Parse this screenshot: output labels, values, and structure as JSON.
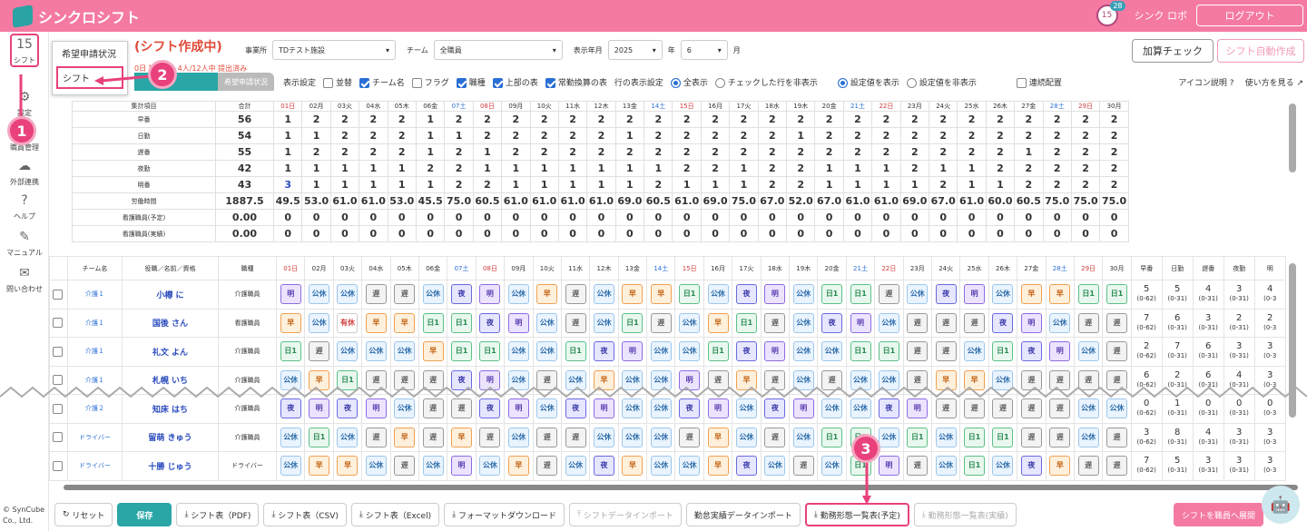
{
  "header": {
    "app_name": "シンクロシフト",
    "badge_count": "28",
    "badge_icon": "15",
    "user": "シンク ロボ",
    "logout": "ログアウト"
  },
  "sidebar": [
    {
      "label": "シフト",
      "icon": "15",
      "name": "sidebar-item-shift"
    },
    {
      "label": "設定",
      "icon": "⚙",
      "name": "sidebar-item-settings"
    },
    {
      "label": "職員管理",
      "icon": "☰",
      "name": "sidebar-item-staff"
    },
    {
      "label": "外部連携",
      "icon": "☁",
      "name": "sidebar-item-external"
    },
    {
      "label": "ヘルプ",
      "icon": "?",
      "name": "sidebar-item-help"
    },
    {
      "label": "マニュアル",
      "icon": "✎",
      "name": "sidebar-item-manual"
    },
    {
      "label": "問い合わせ",
      "icon": "✉",
      "name": "sidebar-item-contact"
    }
  ],
  "copyright": {
    "line1": "© SynCube",
    "line2": "Co., Ltd."
  },
  "popup": {
    "item1": "希望申請状況",
    "item2": "シフト"
  },
  "markers": [
    "1",
    "2",
    "3"
  ],
  "page": {
    "title": "(シフト作成中)",
    "status_prefix": "0日",
    "status": "請状況：4人/12人中 提出済み",
    "tab_request": "希望申請状況"
  },
  "filters": {
    "office_label": "事業所",
    "office_value": "TDテスト施設",
    "team_label": "チーム",
    "team_value": "全職員",
    "month_label": "表示年月",
    "year_value": "2025",
    "year_unit": "年",
    "month_value": "6",
    "month_unit": "月"
  },
  "actions": {
    "check": "加算チェック",
    "auto": "シフト自動作成"
  },
  "display": {
    "label": "表示設定",
    "opt1": "並替",
    "opt2": "チーム名",
    "opt3": "フラグ",
    "opt4": "職種",
    "opt5": "上部の表",
    "opt6": "常勤換算の表",
    "row_label": "行の表示設定",
    "r1": "全表示",
    "r2": "チェックした行を非表示",
    "r3": "設定値を表示",
    "r4": "設定値を非表示",
    "opt7": "連続配置",
    "icon_help": "アイコン説明",
    "howto": "使い方を見る"
  },
  "agg": {
    "head_label": "集計項目",
    "head_total": "合計",
    "days": [
      "01日",
      "02月",
      "03火",
      "04水",
      "05木",
      "06金",
      "07土",
      "08日",
      "09月",
      "10火",
      "11水",
      "12木",
      "13金",
      "14土",
      "15日",
      "16月",
      "17火",
      "18水",
      "19木",
      "20金",
      "21土",
      "22日",
      "23月",
      "24火",
      "25水",
      "26木",
      "27金",
      "28土",
      "29日",
      "30月"
    ],
    "rows": [
      {
        "label": "早番",
        "total": "56",
        "vals": [
          "1",
          "2",
          "2",
          "2",
          "2",
          "1",
          "2",
          "2",
          "2",
          "2",
          "2",
          "2",
          "2",
          "2",
          "2",
          "2",
          "2",
          "2",
          "2",
          "2",
          "2",
          "2",
          "2",
          "2",
          "2",
          "2",
          "2",
          "2",
          "2",
          "2"
        ]
      },
      {
        "label": "日勤",
        "total": "54",
        "vals": [
          "1",
          "1",
          "2",
          "2",
          "2",
          "1",
          "1",
          "2",
          "2",
          "2",
          "2",
          "2",
          "1",
          "2",
          "2",
          "2",
          "2",
          "2",
          "1",
          "2",
          "2",
          "2",
          "2",
          "2",
          "2",
          "2",
          "2",
          "2",
          "2",
          "2"
        ]
      },
      {
        "label": "遅番",
        "total": "55",
        "vals": [
          "1",
          "2",
          "2",
          "2",
          "2",
          "1",
          "2",
          "1",
          "2",
          "2",
          "2",
          "2",
          "2",
          "2",
          "2",
          "2",
          "2",
          "2",
          "2",
          "2",
          "2",
          "2",
          "2",
          "2",
          "2",
          "2",
          "1",
          "2",
          "2",
          "2"
        ]
      },
      {
        "label": "夜勤",
        "total": "42",
        "vals": [
          "1",
          "1",
          "1",
          "1",
          "1",
          "2",
          "2",
          "1",
          "1",
          "1",
          "1",
          "1",
          "1",
          "1",
          "2",
          "2",
          "1",
          "2",
          "2",
          "1",
          "1",
          "1",
          "2",
          "1",
          "1",
          "2",
          "2",
          "2",
          "2",
          "2"
        ]
      },
      {
        "label": "明番",
        "total": "43",
        "vals": [
          "3",
          "1",
          "1",
          "1",
          "1",
          "1",
          "2",
          "2",
          "1",
          "1",
          "1",
          "1",
          "1",
          "2",
          "1",
          "1",
          "1",
          "2",
          "2",
          "1",
          "1",
          "1",
          "1",
          "2",
          "1",
          "1",
          "2",
          "2",
          "2",
          "2"
        ]
      },
      {
        "label": "労働時間",
        "total": "1887.5",
        "vals": [
          "49.5",
          "53.0",
          "61.0",
          "61.0",
          "53.0",
          "45.5",
          "75.0",
          "60.5",
          "61.0",
          "61.0",
          "61.0",
          "61.0",
          "69.0",
          "60.5",
          "61.0",
          "69.0",
          "75.0",
          "67.0",
          "52.0",
          "67.0",
          "61.0",
          "61.0",
          "69.0",
          "67.0",
          "61.0",
          "60.0",
          "60.5",
          "75.0",
          "75.0",
          "75.0"
        ]
      },
      {
        "label": "看護職員(予定)",
        "total": "0.00",
        "vals": [
          "0",
          "0",
          "0",
          "0",
          "0",
          "0",
          "0",
          "0",
          "0",
          "0",
          "0",
          "0",
          "0",
          "0",
          "0",
          "0",
          "0",
          "0",
          "0",
          "0",
          "0",
          "0",
          "0",
          "0",
          "0",
          "0",
          "0",
          "0",
          "0",
          "0"
        ]
      },
      {
        "label": "看護職員(実績)",
        "total": "0.00",
        "vals": [
          "0",
          "0",
          "0",
          "0",
          "0",
          "0",
          "0",
          "0",
          "0",
          "0",
          "0",
          "0",
          "0",
          "0",
          "0",
          "0",
          "0",
          "0",
          "0",
          "0",
          "0",
          "0",
          "0",
          "0",
          "0",
          "0",
          "0",
          "0",
          "0",
          "0"
        ]
      }
    ]
  },
  "grid": {
    "head": {
      "team": "チーム名",
      "role": "役職／名前／資格",
      "job": "職種",
      "sums": [
        "早番",
        "日勤",
        "遅番",
        "夜勤",
        "明"
      ]
    },
    "rows": [
      {
        "team": "介護１",
        "name": "小樽 に",
        "job": "介護職員",
        "shifts": [
          "明",
          "公休",
          "公休",
          "遅",
          "遅",
          "公休",
          "夜",
          "明",
          "公休",
          "早",
          "遅",
          "公休",
          "早",
          "早",
          "日1",
          "公休",
          "夜",
          "明",
          "公休",
          "日1",
          "日1",
          "遅",
          "公休",
          "夜",
          "明",
          "公休",
          "早",
          "早",
          "日1",
          "日1"
        ],
        "sums": [
          {
            "v": "5",
            "r": "(0-62)"
          },
          {
            "v": "5",
            "r": "(0-31)"
          },
          {
            "v": "4",
            "r": "(0-31)"
          },
          {
            "v": "3",
            "r": "(0-31)"
          },
          {
            "v": "4",
            "r": "(0-3"
          }
        ]
      },
      {
        "team": "介護１",
        "name": "国後 さん",
        "job": "看護職員",
        "shifts": [
          "早",
          "公休",
          "有休",
          "早",
          "早",
          "日1",
          "日1",
          "夜",
          "明",
          "公休",
          "遅",
          "公休",
          "日1",
          "遅",
          "公休",
          "早",
          "日1",
          "遅",
          "公休",
          "夜",
          "明",
          "公休",
          "遅",
          "遅",
          "遅",
          "夜",
          "明",
          "公休",
          "遅",
          "遅"
        ],
        "sums": [
          {
            "v": "7",
            "r": "(0-62)"
          },
          {
            "v": "6",
            "r": "(0-31)"
          },
          {
            "v": "3",
            "r": "(0-31)"
          },
          {
            "v": "2",
            "r": "(0-31)"
          },
          {
            "v": "2",
            "r": "(0-3"
          }
        ]
      },
      {
        "team": "介護１",
        "name": "礼文 よん",
        "job": "介護職員",
        "shifts": [
          "日1",
          "遅",
          "公休",
          "公休",
          "公休",
          "早",
          "日1",
          "日1",
          "公休",
          "公休",
          "日1",
          "夜",
          "明",
          "公休",
          "公休",
          "日1",
          "夜",
          "明",
          "公休",
          "公休",
          "日1",
          "日1",
          "遅",
          "遅",
          "公休",
          "日1",
          "夜",
          "明",
          "公休",
          "遅"
        ],
        "sums": [
          {
            "v": "2",
            "r": "(0-62)"
          },
          {
            "v": "7",
            "r": "(0-31)"
          },
          {
            "v": "6",
            "r": "(0-31)"
          },
          {
            "v": "3",
            "r": "(0-31)"
          },
          {
            "v": "3",
            "r": "(0-3"
          }
        ]
      },
      {
        "team": "介護１",
        "name": "札幌 いち",
        "job": "介護職員",
        "shifts": [
          "公休",
          "早",
          "日1",
          "遅",
          "遅",
          "遅",
          "夜",
          "明",
          "公休",
          "遅",
          "公休",
          "早",
          "公休",
          "公休",
          "明",
          "遅",
          "早",
          "遅",
          "公休",
          "遅",
          "公休",
          "公休",
          "遅",
          "早",
          "早",
          "公休",
          "遅",
          "遅",
          "遅",
          "遅"
        ],
        "sums": [
          {
            "v": "6",
            "r": "(0-62)"
          },
          {
            "v": "2",
            "r": "(0-31)"
          },
          {
            "v": "6",
            "r": "(0-31)"
          },
          {
            "v": "4",
            "r": "(0-31)"
          },
          {
            "v": "3",
            "r": "(0-3"
          }
        ]
      },
      {
        "team": "介護２",
        "name": "知床 はち",
        "job": "介護職員",
        "shifts": [
          "夜",
          "明",
          "夜",
          "明",
          "公休",
          "遅",
          "遅",
          "夜",
          "明",
          "公休",
          "夜",
          "明",
          "公休",
          "公休",
          "夜",
          "明",
          "公休",
          "夜",
          "明",
          "公休",
          "公休",
          "夜",
          "明",
          "遅",
          "遅",
          "遅",
          "遅",
          "遅",
          "公休",
          "公休"
        ],
        "sums": [
          {
            "v": "0",
            "r": "(0-62)"
          },
          {
            "v": "1",
            "r": "(0-31)"
          },
          {
            "v": "0",
            "r": "(0-31)"
          },
          {
            "v": "0",
            "r": "(0-31)"
          },
          {
            "v": "0",
            "r": "(0-3"
          }
        ]
      },
      {
        "team": "ドライバー",
        "name": "留萌 きゅう",
        "job": "介護職員",
        "shifts": [
          "公休",
          "日1",
          "公休",
          "遅",
          "早",
          "遅",
          "早",
          "遅",
          "公休",
          "遅",
          "遅",
          "公休",
          "公休",
          "公休",
          "遅",
          "早",
          "公休",
          "遅",
          "公休",
          "日1",
          "日1",
          "公休",
          "日1",
          "公休",
          "日1",
          "日1",
          "遅",
          "遅",
          "公休",
          "遅"
        ],
        "sums": [
          {
            "v": "3",
            "r": "(0-62)"
          },
          {
            "v": "8",
            "r": "(0-31)"
          },
          {
            "v": "4",
            "r": "(0-31)"
          },
          {
            "v": "3",
            "r": "(0-31)"
          },
          {
            "v": "3",
            "r": "(0-3"
          }
        ]
      },
      {
        "team": "ドライバー",
        "name": "十勝 じゅう",
        "job": "ドライバー",
        "shifts": [
          "公休",
          "早",
          "早",
          "公休",
          "遅",
          "公休",
          "明",
          "公休",
          "早",
          "遅",
          "公休",
          "夜",
          "早",
          "公休",
          "公休",
          "早",
          "夜",
          "公休",
          "遅",
          "公休",
          "日1",
          "明",
          "遅",
          "公休",
          "日1",
          "公休",
          "夜",
          "早",
          "遅",
          "遅"
        ],
        "sums": [
          {
            "v": "7",
            "r": "(0-62)"
          },
          {
            "v": "5",
            "r": "(0-31)"
          },
          {
            "v": "3",
            "r": "(0-31)"
          },
          {
            "v": "3",
            "r": "(0-31)"
          },
          {
            "v": "3",
            "r": "(0-3"
          }
        ]
      }
    ]
  },
  "bottom": {
    "reset": "リセット",
    "save": "保存",
    "pdf": "シフト表（PDF)",
    "csv": "シフト表（CSV)",
    "excel": "シフト表（Excel)",
    "format": "フォーマットダウンロード",
    "import": "シフトデータインポート",
    "attendance": "勤怠実績データインポート",
    "plan": "勤務形態一覧表(予定)",
    "actual": "勤務形態一覧表(実績)",
    "publish": "シフトを職員へ展開"
  }
}
